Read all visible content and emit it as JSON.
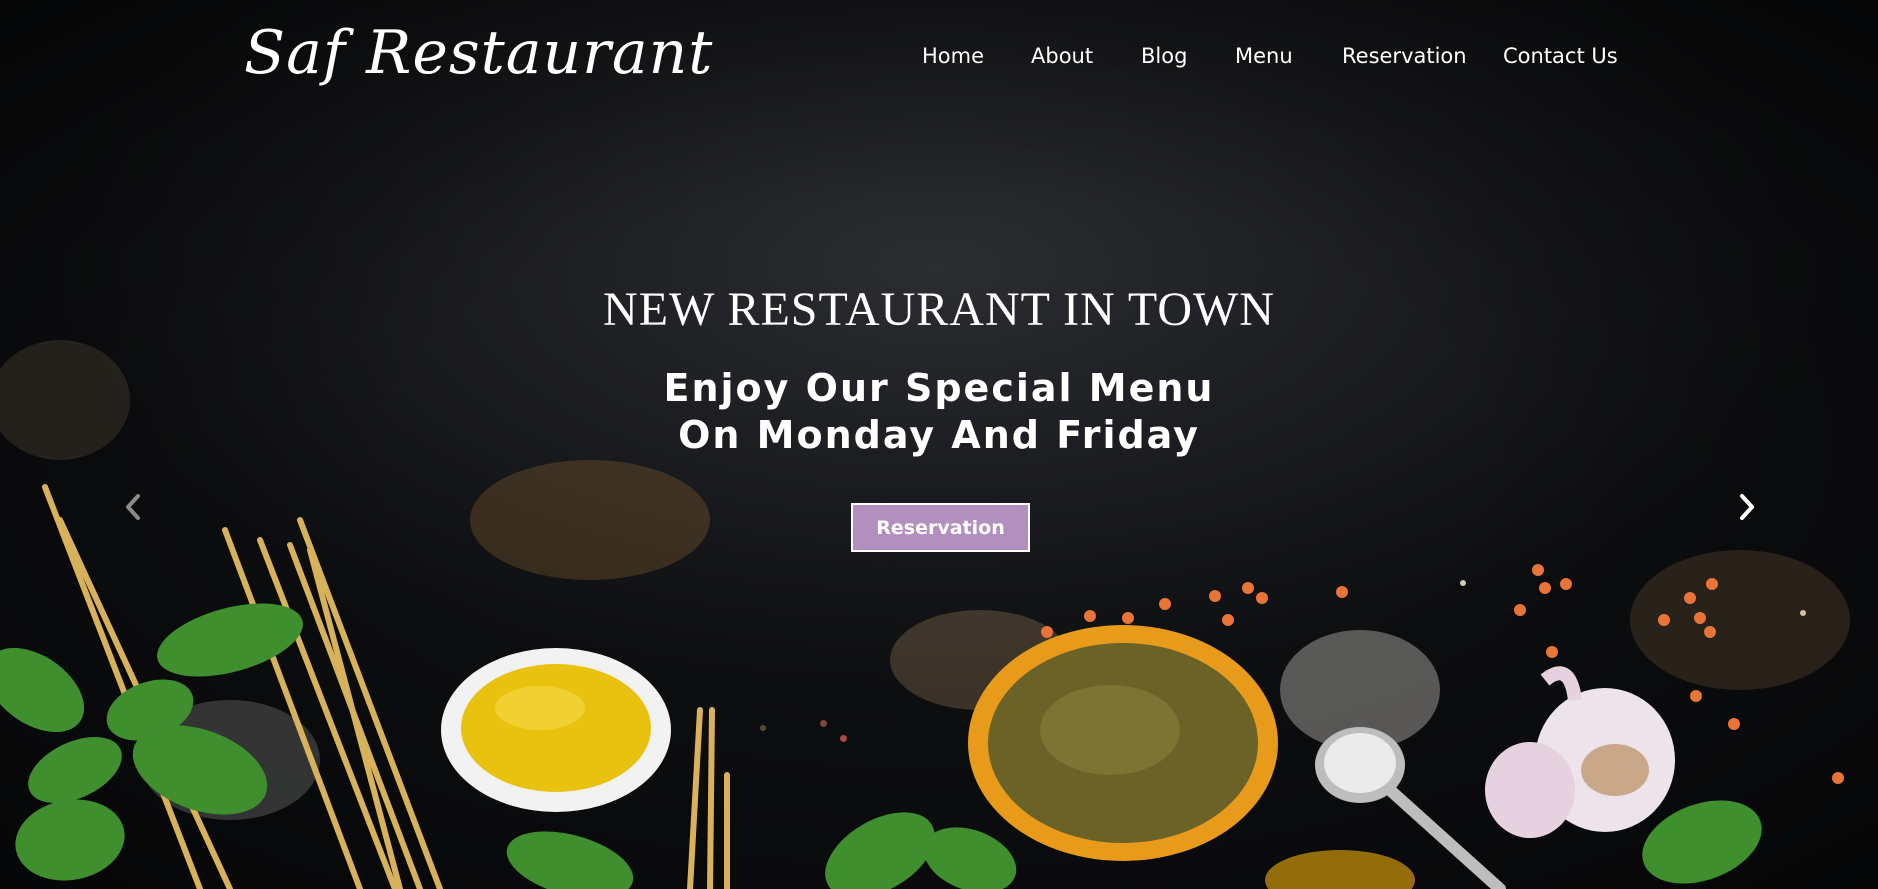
{
  "brand": {
    "name": "Saf Restaurant"
  },
  "nav": {
    "items": [
      {
        "label": "Home"
      },
      {
        "label": "About"
      },
      {
        "label": "Blog"
      },
      {
        "label": "Menu"
      },
      {
        "label": "Reservation"
      },
      {
        "label": "Contact Us"
      }
    ]
  },
  "hero": {
    "headline": "NEW RESTAURANT IN TOWN",
    "subline_1": "Enjoy Our Special Menu",
    "subline_2": "On Monday And Friday",
    "button_label": "Reservation",
    "prev_icon": "chevron-left-icon",
    "next_icon": "chevron-right-icon"
  },
  "colors": {
    "accent": "#b38fbf",
    "background": "#1a1b1e",
    "text": "#ffffff"
  }
}
